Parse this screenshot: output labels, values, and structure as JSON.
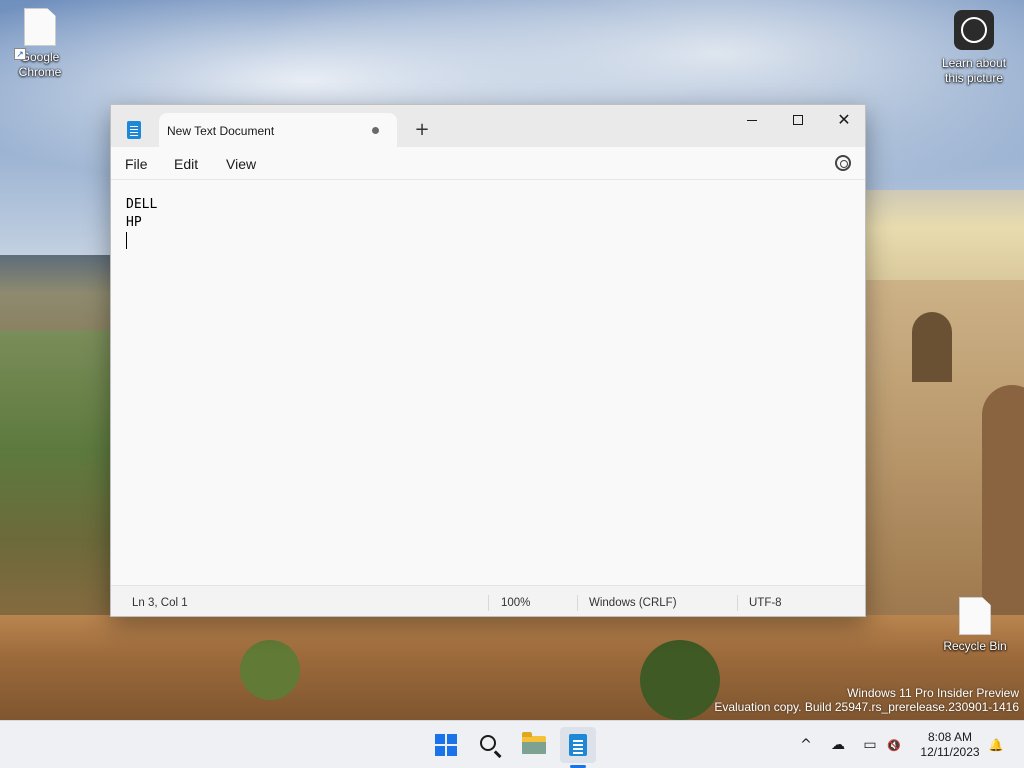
{
  "desktop": {
    "icons": [
      {
        "label_line1": "Google",
        "label_line2": "Chrome"
      },
      {
        "label_line1": "Learn about",
        "label_line2": "this picture"
      },
      {
        "label_line1": "Recycle Bin"
      }
    ],
    "watermark_line1": "Windows 11 Pro Insider Preview",
    "watermark_line2": "Evaluation copy. Build 25947.rs_prerelease.230901-1416"
  },
  "window": {
    "tab_title": "New Text Document",
    "tab_unsaved": true,
    "new_tab_glyph": "+",
    "controls": {
      "minimize": "minimize-icon",
      "maximize": "maximize-icon",
      "close": "close-icon"
    },
    "close_glyph": "✕",
    "menu": [
      "File",
      "Edit",
      "View"
    ],
    "settings_icon": "gear-icon",
    "content_lines": [
      "DELL",
      "HP",
      ""
    ],
    "status": {
      "position": "Ln 3, Col 1",
      "zoom": "100%",
      "line_ending": "Windows (CRLF)",
      "encoding": "UTF-8"
    }
  },
  "taskbar": {
    "pinned": [
      {
        "name": "start",
        "icon": "windows-logo-icon"
      },
      {
        "name": "search",
        "icon": "search-icon"
      },
      {
        "name": "file-explorer",
        "icon": "folder-icon"
      },
      {
        "name": "notepad",
        "icon": "notepad-icon",
        "active": true
      }
    ],
    "tray": {
      "chevron_glyph": "^",
      "cloud_glyph": "☁",
      "network_glyph": "▭",
      "volume_glyph": "🔇",
      "bell_glyph": "🔔"
    },
    "time": "8:08 AM",
    "date": "12/11/2023"
  },
  "colors": {
    "accent": "#1a73e8",
    "notepad_blue": "#1e88d8",
    "taskbar_bg": "#eef0f3"
  }
}
